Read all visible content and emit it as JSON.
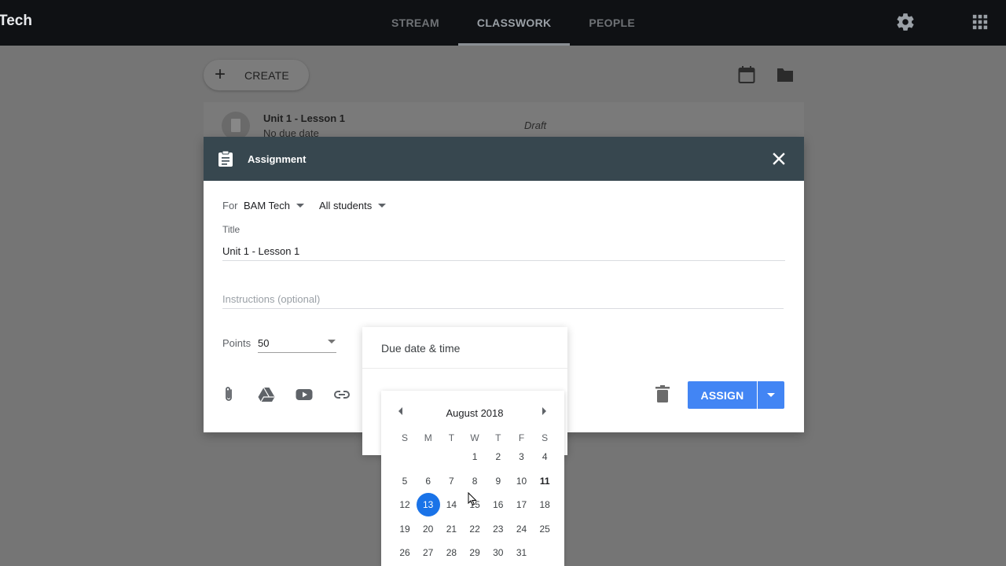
{
  "app": {
    "brand": "Tech"
  },
  "nav": {
    "tabs": [
      "STREAM",
      "CLASSWORK",
      "PEOPLE"
    ],
    "active": "CLASSWORK"
  },
  "icons": {
    "settings": "gear-icon",
    "apps": "apps-grid-icon",
    "calendar": "calendar-icon",
    "folder": "folder-icon"
  },
  "toolbar": {
    "create_label": "CREATE"
  },
  "classwork_item": {
    "title": "Unit 1 - Lesson 1",
    "subtitle": "No due date",
    "status": "Draft"
  },
  "dialog": {
    "title": "Assignment",
    "for_label": "For",
    "class_name": "BAM Tech",
    "audience": "All students",
    "title_label": "Title",
    "title_value": "Unit 1 - Lesson 1",
    "instructions_placeholder": "Instructions (optional)",
    "points_label": "Points",
    "points_value": "50",
    "assign_label": "ASSIGN"
  },
  "due": {
    "title": "Due date & time"
  },
  "calendar": {
    "month": "August 2018",
    "weekdays": [
      "S",
      "M",
      "T",
      "W",
      "T",
      "F",
      "S"
    ],
    "first_weekday_index": 3,
    "days_in_month": 31,
    "today": 11,
    "selected": 13
  },
  "colors": {
    "accent": "#4285f4",
    "header": "#37474f",
    "selected_day": "#1a73e8"
  }
}
